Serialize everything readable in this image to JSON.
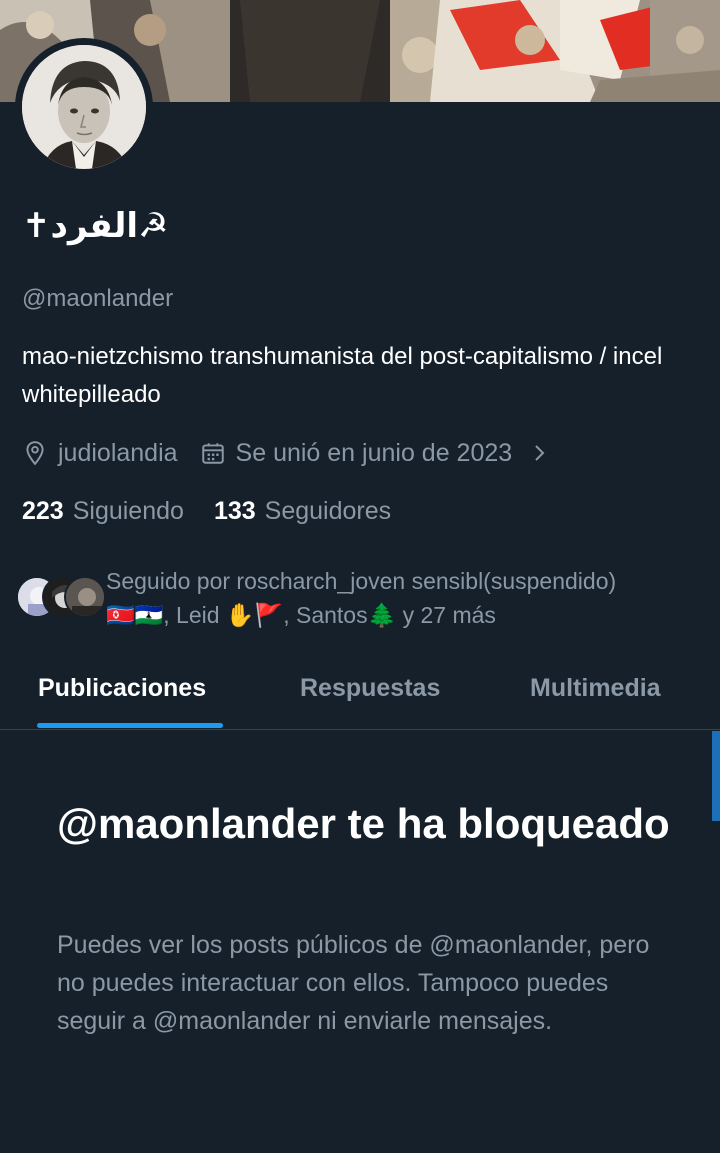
{
  "profile": {
    "display_name": "✝الفرد☭",
    "handle": "@maonlander",
    "bio": "mao-nietzchismo transhumanista del post-capitalismo / incel whitepilleado",
    "location": "judiolandia",
    "joined": "Se unió en junio de 2023"
  },
  "stats": {
    "following_count": "223",
    "following_label": "Siguiendo",
    "followers_count": "133",
    "followers_label": "Seguidores"
  },
  "followed_by": {
    "line1": "Seguido por roscharch_joven sensibl(suspendido)",
    "line2": "🇰🇵🇱🇸, Leid ✋🚩, Santos🌲 y 27 más"
  },
  "tabs": [
    {
      "label": "Publicaciones",
      "active": true
    },
    {
      "label": "Respuestas",
      "active": false
    },
    {
      "label": "Multimedia",
      "active": false
    }
  ],
  "blocked": {
    "title": "@maonlander te ha bloqueado",
    "description": "Puedes ver los posts públicos de @maonlander, pero no puedes interactuar con ellos. Tampoco puedes seguir a @maonlander ni enviarle mensajes."
  },
  "icons": {
    "location": "location-pin-icon",
    "calendar": "calendar-icon",
    "chevron": "chevron-right-icon"
  },
  "colors": {
    "background": "#15202b",
    "secondary_text": "#8b98a5",
    "accent": "#1d9bf0",
    "divider": "#38444d"
  }
}
